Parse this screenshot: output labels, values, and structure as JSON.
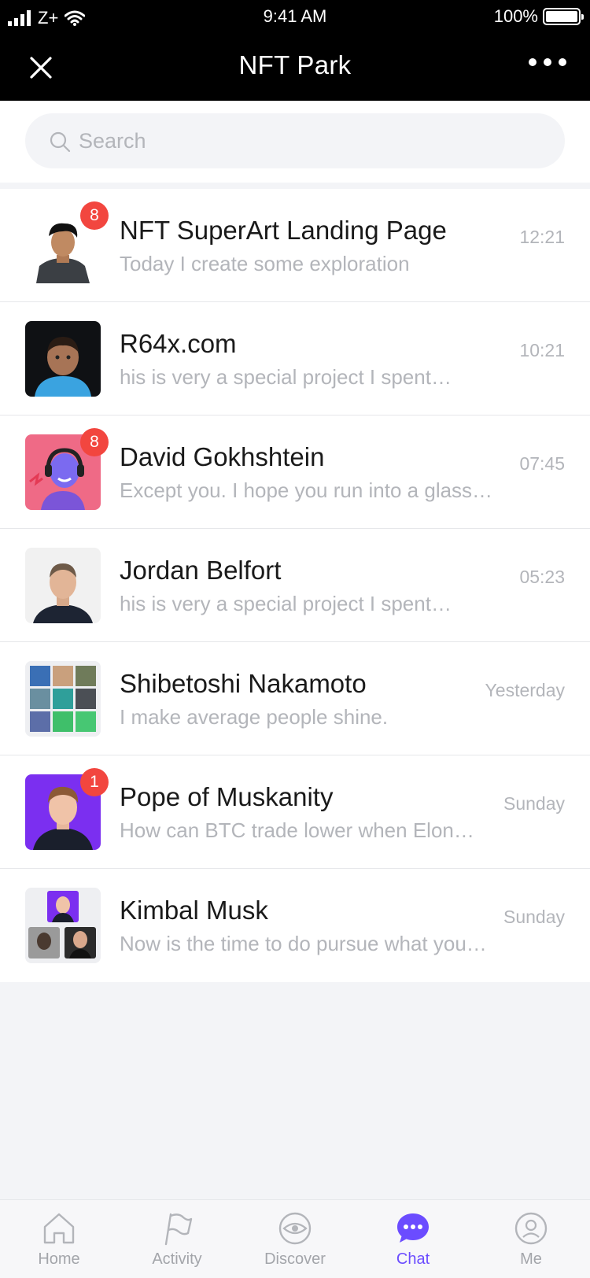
{
  "status_bar": {
    "carrier": "Z+",
    "time": "9:41 AM",
    "battery": "100%"
  },
  "nav": {
    "title": "NFT Park",
    "close_icon": "close-icon",
    "more_icon": "more-dots-icon"
  },
  "search": {
    "placeholder": "Search",
    "value": ""
  },
  "chats": [
    {
      "name": "NFT SuperArt Landing Page",
      "message": "Today I create some exploration",
      "time": "12:21",
      "badge": "8"
    },
    {
      "name": "R64x.com",
      "message": "his is very a special project I spent…",
      "time": "10:21",
      "badge": ""
    },
    {
      "name": "David Gokhshtein",
      "message": "Except you. I hope you run into a glass…",
      "time": "07:45",
      "badge": "8"
    },
    {
      "name": "Jordan Belfort",
      "message": "his is very a special project I spent…",
      "time": "05:23",
      "badge": ""
    },
    {
      "name": "Shibetoshi Nakamoto",
      "message": "I make average people shine.",
      "time": "Yesterday",
      "badge": ""
    },
    {
      "name": "Pope of Muskanity",
      "message": "How can BTC trade lower when Elon…",
      "time": "Sunday",
      "badge": "1"
    },
    {
      "name": "Kimbal Musk",
      "message": "Now is the time to do pursue what you…",
      "time": "Sunday",
      "badge": ""
    }
  ],
  "tabs": [
    {
      "label": "Home",
      "icon": "home-icon"
    },
    {
      "label": "Activity",
      "icon": "flag-icon"
    },
    {
      "label": "Discover",
      "icon": "eye-icon"
    },
    {
      "label": "Chat",
      "icon": "chat-bubble-icon",
      "active": true
    },
    {
      "label": "Me",
      "icon": "profile-icon"
    }
  ],
  "colors": {
    "accent": "#6b4cff",
    "badge": "#f2463f",
    "header_bg": "#000000",
    "muted_text": "#b3b5ba",
    "background": "#f3f4f7"
  }
}
